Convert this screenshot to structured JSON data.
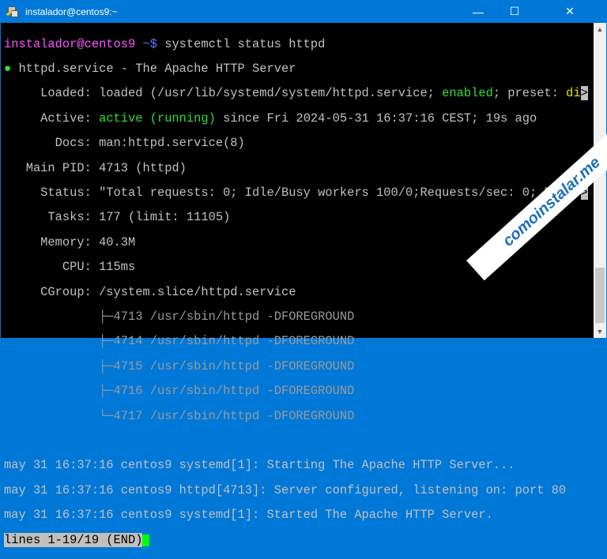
{
  "window": {
    "title": "instalador@centos9:~",
    "minimize": "—",
    "maximize": "☐",
    "close": "✕"
  },
  "terminal": {
    "prompt_user": "instalador@centos9",
    "prompt_path": " ~$",
    "command": " systemctl status httpd",
    "bullet": "●",
    "service_line": " httpd.service - The Apache HTTP Server",
    "loaded_pre": "     Loaded: loaded (/usr/lib/systemd/system/httpd.service; ",
    "loaded_enabled": "enabled",
    "loaded_mid": "; preset: ",
    "loaded_di": "di",
    "trunc": ">",
    "active_pre": "     Active: ",
    "active_state": "active (running)",
    "active_post": " since Fri 2024-05-31 16:37:16 CEST; 19s ago",
    "docs": "       Docs: man:httpd.service(8)",
    "mainpid": "   Main PID: 4713 (httpd)",
    "status": "     Status: \"Total requests: 0; Idle/Busy workers 100/0;Requests/sec: 0; Bytes",
    "tasks": "      Tasks: 177 (limit: 11105)",
    "memory": "     Memory: 40.3M",
    "cpu": "        CPU: 115ms",
    "cgroup": "     CGroup: /system.slice/httpd.service",
    "procs": [
      "             ├─4713 /usr/sbin/httpd -DFOREGROUND",
      "             ├─4714 /usr/sbin/httpd -DFOREGROUND",
      "             ├─4715 /usr/sbin/httpd -DFOREGROUND",
      "             ├─4716 /usr/sbin/httpd -DFOREGROUND",
      "             └─4717 /usr/sbin/httpd -DFOREGROUND"
    ],
    "logs": [
      "may 31 16:37:16 centos9 systemd[1]: Starting The Apache HTTP Server...",
      "may 31 16:37:16 centos9 httpd[4713]: Server configured, listening on: port 80",
      "may 31 16:37:16 centos9 systemd[1]: Started The Apache HTTP Server."
    ],
    "pager": "lines 1-19/19 (END)"
  },
  "watermark": "comoinstalar.me"
}
